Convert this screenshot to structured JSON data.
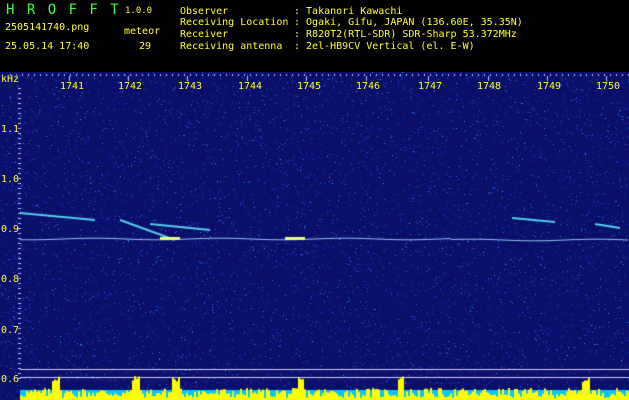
{
  "app": {
    "name": "H R O F F T",
    "version": "1.0.0"
  },
  "file": {
    "name": "2505141740.png",
    "datetime": "25.05.14 17:40",
    "count_label": "meteor",
    "count_value": "29"
  },
  "info": {
    "labels": [
      "Observer",
      "Receiving Location",
      "Receiver",
      "Receiving antenna"
    ],
    "values": [
      ": Takanori Kawachi",
      ": Ogaki, Gifu, JAPAN (136.60E, 35.35N)",
      ": R820T2(RTL-SDR) SDR-Sharp 53.372MHz",
      ": 2el-HB9CV Vertical (el. E-W)"
    ]
  },
  "plot": {
    "y_unit": "kHz",
    "x_ticks": [
      "1741",
      "1742",
      "1743",
      "1744",
      "1745",
      "1746",
      "1747",
      "1748",
      "1749",
      "1750"
    ],
    "y_ticks": [
      "1.1",
      "1.0",
      "0.9",
      "0.8",
      "0.7",
      "0.6"
    ],
    "colors": {
      "background": "#0a0f6a",
      "axis_text": "#ffff33",
      "carrier": "#9fd8ff",
      "meteor_echo": "#5df2ff",
      "bottom_bars": "#ffff00",
      "bottom_level": "#00c8ff"
    }
  }
}
